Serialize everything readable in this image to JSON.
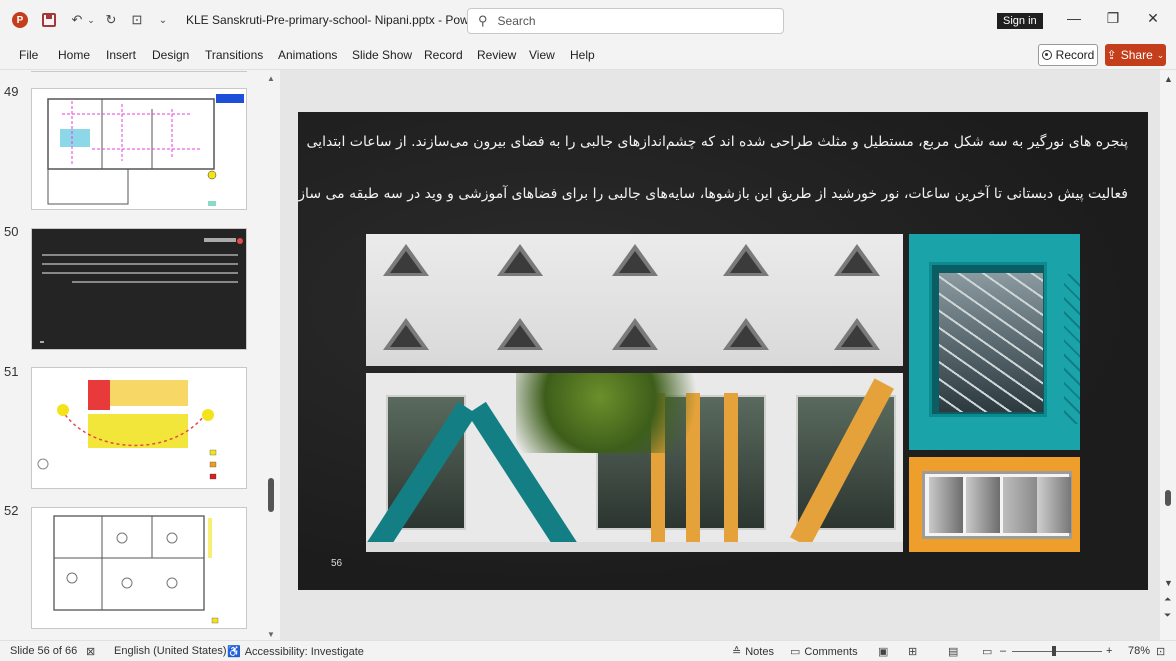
{
  "titlebar": {
    "app_logo": "P",
    "doc_title": "KLE Sanskruti-Pre-primary-school- Nipani.pptx  -  PowerP...",
    "search_placeholder": "Search",
    "signin_label": "Sign in"
  },
  "ribbon": {
    "tabs": [
      "File",
      "Home",
      "Insert",
      "Design",
      "Transitions",
      "Animations",
      "Slide Show",
      "Record",
      "Review",
      "View",
      "Help"
    ],
    "record_label": "Record",
    "share_label": "Share"
  },
  "thumbnails": [
    {
      "number": "49"
    },
    {
      "number": "50"
    },
    {
      "number": "51"
    },
    {
      "number": "52"
    }
  ],
  "slide": {
    "line1": "پنجره های نورگیر به سه شکل مربع، مستطیل و مثلث طراحی شده اند که چشم‌اندازهای جالبی را به فضای بیرون می‌سازند. از  ساعات ابتدایی",
    "line2": "فعالیت پیش دبستانی تا آخرین ساعات، نور خورشید از طریق این بازشوها، سایه‌های جالبی را برای فضاهای آموزشی و وید در سه طبقه می سازد.",
    "page_number": "56"
  },
  "statusbar": {
    "slide_count": "Slide 56 of 66",
    "language": "English (United States)",
    "accessibility": "Accessibility: Investigate",
    "notes_label": "Notes",
    "comments_label": "Comments",
    "zoom": "78%"
  },
  "colors": {
    "brand": "#c43e1c",
    "slide_bg": "#1e1e1e",
    "teal": "#1aa4a9",
    "orange": "#ee9e2a"
  }
}
